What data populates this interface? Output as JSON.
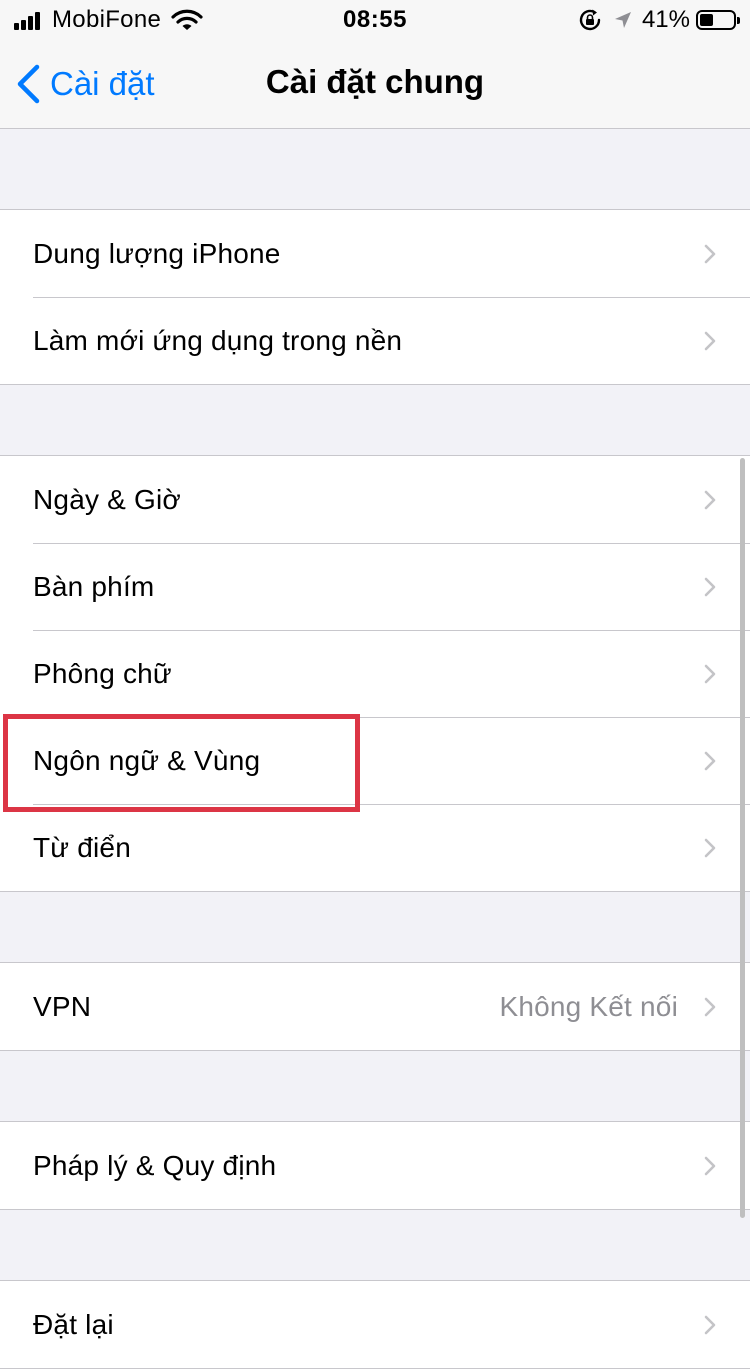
{
  "status_bar": {
    "carrier": "MobiFone",
    "time": "08:55",
    "battery_percent": "41%",
    "battery_level": 0.41,
    "icons": [
      "signal-bars-icon",
      "wifi-icon",
      "rotation-lock-icon",
      "location-arrow-icon",
      "battery-icon"
    ]
  },
  "nav": {
    "back_label": "Cài đặt",
    "title": "Cài đặt chung"
  },
  "groups": [
    {
      "rows": [
        {
          "label": "Dung lượng iPhone",
          "value": ""
        },
        {
          "label": "Làm mới ứng dụng trong nền",
          "value": ""
        }
      ]
    },
    {
      "rows": [
        {
          "label": "Ngày & Giờ",
          "value": ""
        },
        {
          "label": "Bàn phím",
          "value": ""
        },
        {
          "label": "Phông chữ",
          "value": ""
        },
        {
          "label": "Ngôn ngữ & Vùng",
          "value": "",
          "highlighted": true
        },
        {
          "label": "Từ điển",
          "value": ""
        }
      ]
    },
    {
      "rows": [
        {
          "label": "VPN",
          "value": "Không Kết nối"
        }
      ]
    },
    {
      "rows": [
        {
          "label": "Pháp lý & Quy định",
          "value": ""
        }
      ]
    },
    {
      "rows": [
        {
          "label": "Đặt lại",
          "value": ""
        }
      ]
    }
  ],
  "colors": {
    "accent": "#007aff",
    "highlight": "#dc3545",
    "chevron": "#c4c4c7",
    "secondary_text": "#8e8e93"
  }
}
